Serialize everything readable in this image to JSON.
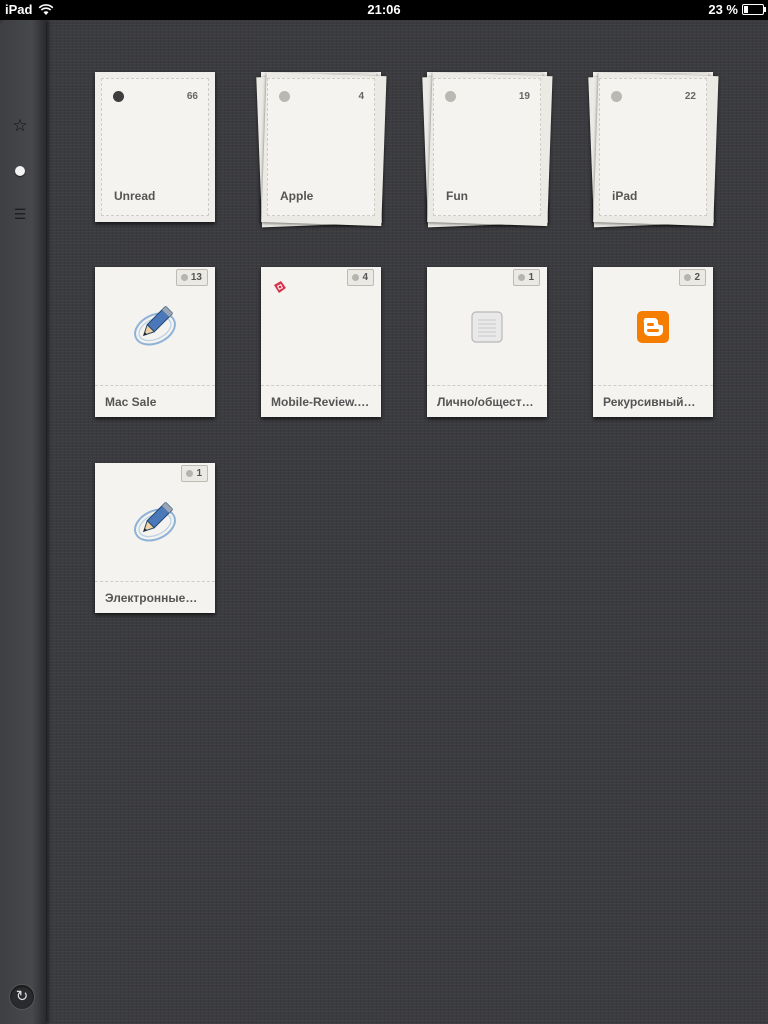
{
  "status_bar": {
    "carrier": "iPad",
    "time": "21:06",
    "battery": "23 %",
    "battery_level": 0.23
  },
  "sidebar": {
    "icons": [
      "star-icon",
      "dot-icon",
      "menu-icon"
    ],
    "refresh_icon": "refresh-icon"
  },
  "groups": [
    {
      "title": "Unread",
      "count": "66",
      "dot": "dark"
    },
    {
      "title": "Apple",
      "count": "4",
      "dot": "light"
    },
    {
      "title": "Fun",
      "count": "19",
      "dot": "light"
    },
    {
      "title": "iPad",
      "count": "22",
      "dot": "light"
    }
  ],
  "feeds": [
    {
      "title": "Mac Sale",
      "count": "13",
      "icon": "livejournal-pencil-icon"
    },
    {
      "title": "Mobile-Review.…",
      "count": "4",
      "icon": "mobile-review-favicon"
    },
    {
      "title": "Лично/общест…",
      "count": "1",
      "icon": "notepad-icon"
    },
    {
      "title": "Рекурсивный…",
      "count": "2",
      "icon": "blogger-icon"
    },
    {
      "title": "Электронные…",
      "count": "1",
      "icon": "livejournal-pencil-icon"
    }
  ],
  "colors": {
    "background": "#3b3c40",
    "card": "#efeeea",
    "blogger_orange": "#f57d00"
  }
}
